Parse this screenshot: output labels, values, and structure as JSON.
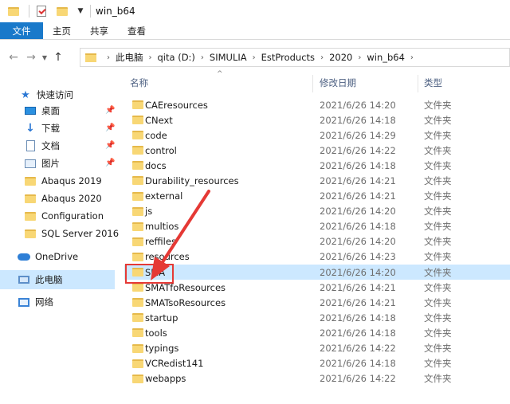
{
  "window": {
    "title": "win_b64"
  },
  "ribbon": {
    "tabs": [
      "文件",
      "主页",
      "共享",
      "查看"
    ]
  },
  "address": {
    "crumbs": [
      "此电脑",
      "qita (D:)",
      "SIMULIA",
      "EstProducts",
      "2020",
      "win_b64"
    ]
  },
  "columns": {
    "name": "名称",
    "date": "修改日期",
    "type": "类型"
  },
  "nav": {
    "quick_access": "快速访问",
    "desktop": "桌面",
    "downloads": "下载",
    "documents": "文档",
    "pictures": "图片",
    "folders": [
      "Abaqus 2019",
      "Abaqus 2020",
      "Configuration",
      "SQL Server 2016"
    ],
    "onedrive": "OneDrive",
    "this_pc": "此电脑",
    "network": "网络"
  },
  "files": [
    {
      "name": "CAEresources",
      "date": "2021/6/26 14:20",
      "type": "文件夹"
    },
    {
      "name": "CNext",
      "date": "2021/6/26 14:18",
      "type": "文件夹"
    },
    {
      "name": "code",
      "date": "2021/6/26 14:29",
      "type": "文件夹"
    },
    {
      "name": "control",
      "date": "2021/6/26 14:22",
      "type": "文件夹"
    },
    {
      "name": "docs",
      "date": "2021/6/26 14:18",
      "type": "文件夹"
    },
    {
      "name": "Durability_resources",
      "date": "2021/6/26 14:21",
      "type": "文件夹"
    },
    {
      "name": "external",
      "date": "2021/6/26 14:21",
      "type": "文件夹"
    },
    {
      "name": "js",
      "date": "2021/6/26 14:20",
      "type": "文件夹"
    },
    {
      "name": "multios",
      "date": "2021/6/26 14:18",
      "type": "文件夹"
    },
    {
      "name": "reffiles",
      "date": "2021/6/26 14:20",
      "type": "文件夹"
    },
    {
      "name": "resources",
      "date": "2021/6/26 14:23",
      "type": "文件夹"
    },
    {
      "name": "SMA",
      "date": "2021/6/26 14:20",
      "type": "文件夹"
    },
    {
      "name": "SMATfoResources",
      "date": "2021/6/26 14:21",
      "type": "文件夹"
    },
    {
      "name": "SMATsoResources",
      "date": "2021/6/26 14:21",
      "type": "文件夹"
    },
    {
      "name": "startup",
      "date": "2021/6/26 14:18",
      "type": "文件夹"
    },
    {
      "name": "tools",
      "date": "2021/6/26 14:18",
      "type": "文件夹"
    },
    {
      "name": "typings",
      "date": "2021/6/26 14:22",
      "type": "文件夹"
    },
    {
      "name": "VCRedist141",
      "date": "2021/6/26 14:18",
      "type": "文件夹"
    },
    {
      "name": "webapps",
      "date": "2021/6/26 14:22",
      "type": "文件夹"
    }
  ],
  "selected_index": 11,
  "colors": {
    "accent": "#1979ca",
    "selection": "#cce8ff",
    "annotation": "#e53935"
  }
}
